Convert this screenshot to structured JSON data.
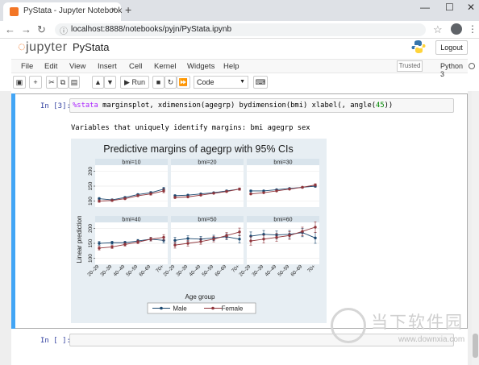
{
  "browser": {
    "tab_title": "PyStata - Jupyter Notebook",
    "tab_close": "×",
    "new_tab": "+",
    "minimize": "—",
    "maximize": "☐",
    "close": "✕",
    "url": "localhost:8888/notebooks/pyjn/PyStata.ipynb"
  },
  "jupyter": {
    "logo_text": "jupyter",
    "notebook_name": "PyStata",
    "logout_label": "Logout",
    "menu": [
      "File",
      "Edit",
      "View",
      "Insert",
      "Cell",
      "Kernel",
      "Widgets",
      "Help"
    ],
    "trusted_label": "Trusted",
    "kernel_label": "Python 3",
    "run_label": "Run",
    "cell_type": "Code"
  },
  "cells": [
    {
      "prompt": "In [3]:",
      "code_magic": "%stata",
      "code_rest": " marginsplot, xdimension(agegrp) bydimension(bmi) xlabel(, angle(",
      "code_num": "45",
      "code_tail": "))",
      "output_text": "Variables that uniquely identify margins: bmi agegrp sex"
    },
    {
      "prompt": "In [ ]:"
    }
  ],
  "watermark": {
    "chinese": "当下软件园",
    "url": "www.downxia.com"
  },
  "colors": {
    "male": "#1a476f",
    "female": "#90353b",
    "chart_bg": "#e7eef3",
    "cell_selected": "#42a5f5"
  },
  "chart_data": {
    "type": "line",
    "title": "Predictive margins of agegrp with 95% CIs",
    "xlabel": "Age group",
    "ylabel": "Linear prediction",
    "categories": [
      "20–29",
      "30–39",
      "40–49",
      "50–59",
      "60–69",
      "70+"
    ],
    "yticks": [
      100,
      150,
      200
    ],
    "ylim": [
      80,
      220
    ],
    "legend_position": "bottom",
    "grid": true,
    "panels": [
      {
        "title": "bmi=10",
        "series": [
          {
            "name": "Male",
            "values": [
              108,
              104,
              112,
              122,
              128,
              140
            ],
            "ci": [
              4,
              3,
              3,
              3,
              4,
              6
            ]
          },
          {
            "name": "Female",
            "values": [
              100,
              102,
              108,
              118,
              124,
              134
            ],
            "ci": [
              4,
              3,
              3,
              3,
              4,
              6
            ]
          }
        ]
      },
      {
        "title": "bmi=20",
        "series": [
          {
            "name": "Male",
            "values": [
              118,
              120,
              124,
              128,
              134,
              140
            ],
            "ci": [
              3,
              2,
              2,
              2,
              3,
              4
            ]
          },
          {
            "name": "Female",
            "values": [
              112,
              114,
              120,
              126,
              132,
              140
            ],
            "ci": [
              3,
              2,
              2,
              2,
              3,
              4
            ]
          }
        ]
      },
      {
        "title": "bmi=30",
        "series": [
          {
            "name": "Male",
            "values": [
              134,
              134,
              138,
              142,
              146,
              150
            ],
            "ci": [
              3,
              2,
              2,
              2,
              3,
              4
            ]
          },
          {
            "name": "Female",
            "values": [
              124,
              128,
              134,
              140,
              146,
              154
            ],
            "ci": [
              3,
              2,
              2,
              2,
              3,
              4
            ]
          }
        ]
      },
      {
        "title": "bmi=40",
        "series": [
          {
            "name": "Male",
            "values": [
              150,
              152,
              152,
              158,
              164,
              160
            ],
            "ci": [
              6,
              5,
              5,
              5,
              6,
              9
            ]
          },
          {
            "name": "Female",
            "values": [
              134,
              138,
              146,
              154,
              164,
              170
            ],
            "ci": [
              6,
              5,
              5,
              5,
              6,
              9
            ]
          }
        ]
      },
      {
        "title": "bmi=50",
        "series": [
          {
            "name": "Male",
            "values": [
              160,
              166,
              164,
              168,
              172,
              164
            ],
            "ci": [
              10,
              9,
              9,
              9,
              10,
              13
            ]
          },
          {
            "name": "Female",
            "values": [
              144,
              150,
              156,
              164,
              176,
              188
            ],
            "ci": [
              10,
              9,
              9,
              9,
              10,
              13
            ]
          }
        ]
      },
      {
        "title": "bmi=60",
        "series": [
          {
            "name": "Male",
            "values": [
              174,
              180,
              178,
              180,
              186,
              168
            ],
            "ci": [
              14,
              13,
              13,
              13,
              14,
              18
            ]
          },
          {
            "name": "Female",
            "values": [
              158,
              164,
              170,
              176,
              190,
              204
            ],
            "ci": [
              14,
              13,
              13,
              13,
              14,
              18
            ]
          }
        ]
      }
    ]
  }
}
